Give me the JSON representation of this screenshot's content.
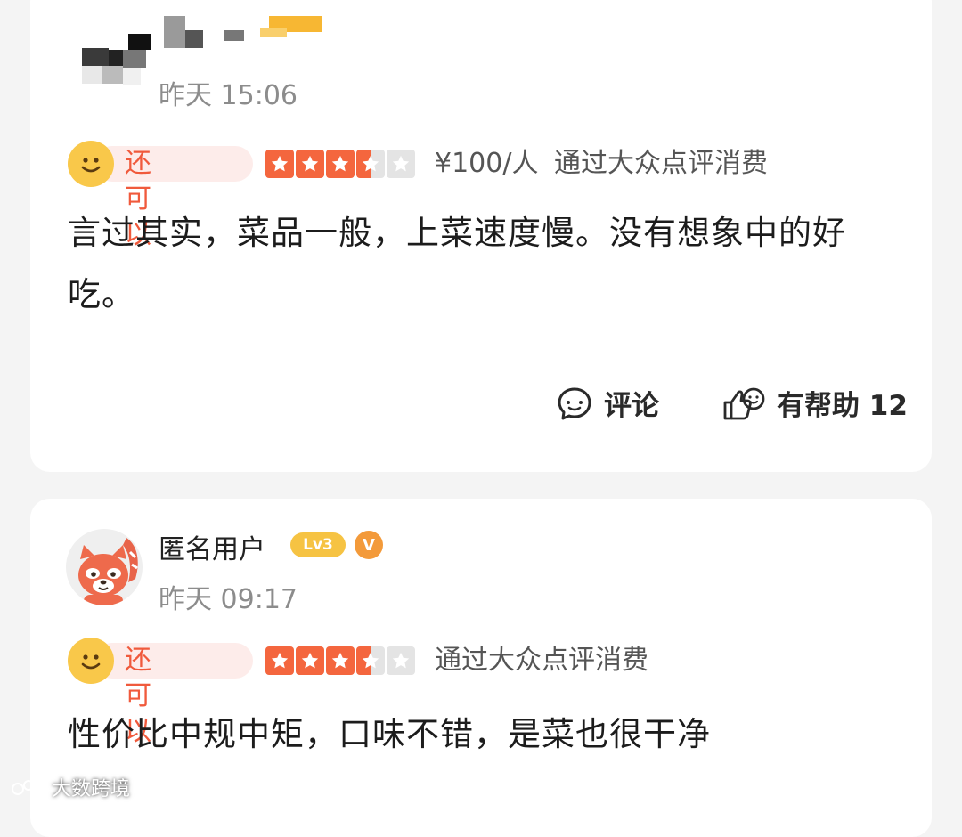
{
  "reviews": [
    {
      "user_name": "",
      "time": "昨天 15:06",
      "mood": "还可以",
      "rating": 3.5,
      "price": "¥100/人",
      "source": "通过大众点评消费",
      "text": "言过其实，菜品一般，上菜速度慢。没有想象中的好吃。",
      "actions": {
        "comment_label": "评论",
        "helpful_label": "有帮助 12"
      }
    },
    {
      "user_name": "匿名用户",
      "level": "Lv3",
      "verified": "V",
      "time": "昨天 09:17",
      "mood": "还可以",
      "rating": 3.5,
      "source": "通过大众点评消费",
      "text": "性价比中规中矩，口味不错，是菜也很干净"
    }
  ],
  "watermark": "大数跨境",
  "icons": {
    "smiley": "smiley-face-icon",
    "star": "star-icon",
    "comment": "comment-bubble-icon",
    "helpful": "thumbs-up-icon",
    "avatar": "red-panda-avatar"
  },
  "colors": {
    "accent": "#f4663e",
    "mood_text": "#f05a3c",
    "mood_bg": "#fdecea",
    "smiley": "#f9c84a",
    "star_empty": "#e4e4e4",
    "level_badge": "#f6c343",
    "verified_badge": "#f39a3a"
  }
}
